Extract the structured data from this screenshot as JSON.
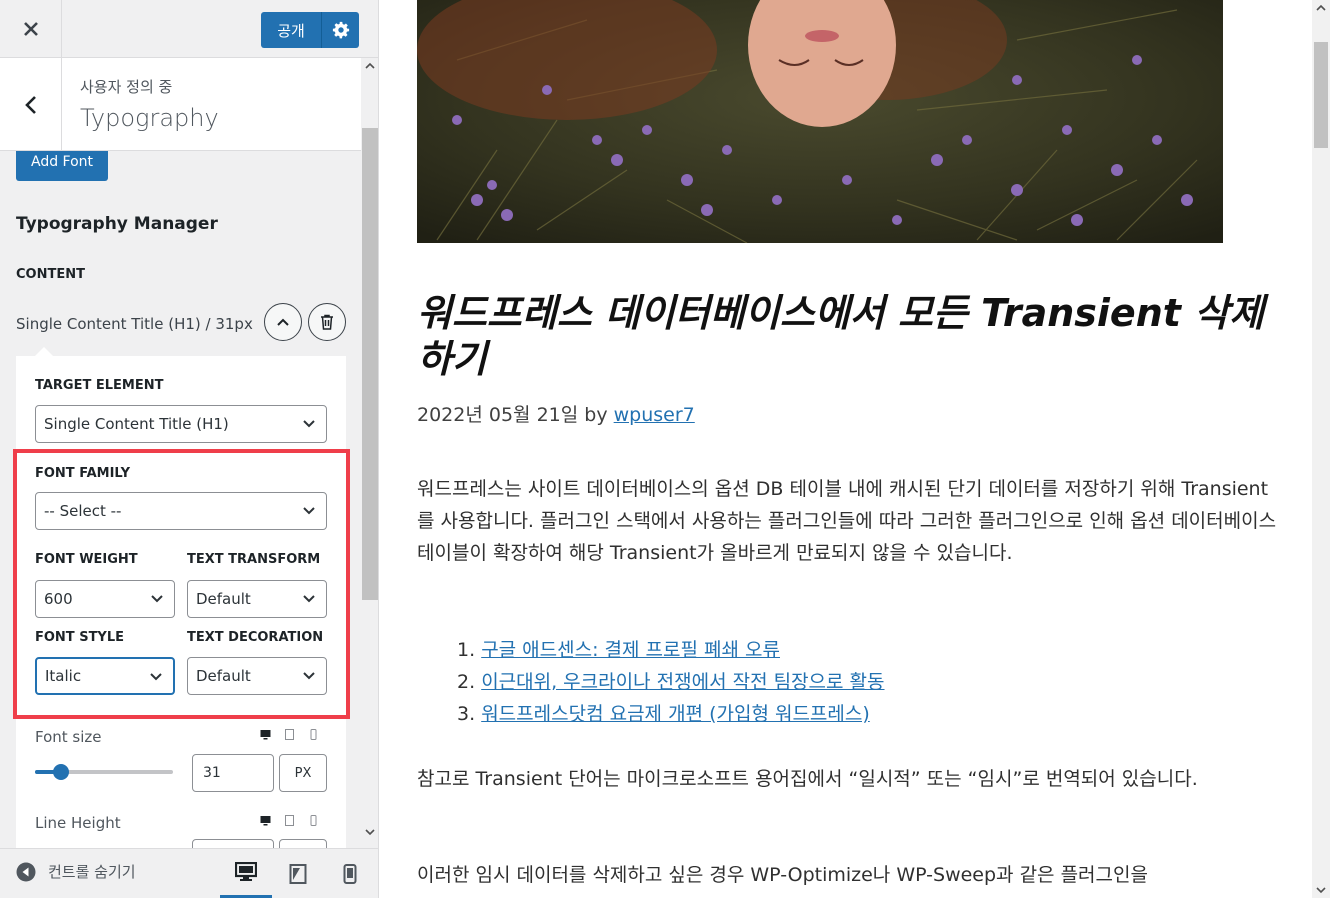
{
  "topbar": {
    "close_icon": "close-icon",
    "publish_label": "공개",
    "settings_icon": "gear-icon"
  },
  "section": {
    "subtitle": "사용자 정의 중",
    "title": "Typography"
  },
  "panel": {
    "add_font_label": "Add Font",
    "manager_title": "Typography Manager",
    "group_label": "CONTENT",
    "item_label": "Single Content Title (H1) / 31px",
    "target_label": "TARGET ELEMENT",
    "target_value": "Single Content Title (H1)",
    "font_family_label": "FONT FAMILY",
    "font_family_value": "-- Select --",
    "font_weight_label": "FONT WEIGHT",
    "font_weight_value": "600",
    "text_transform_label": "TEXT TRANSFORM",
    "text_transform_value": "Default",
    "font_style_label": "FONT STYLE",
    "font_style_value": "Italic",
    "text_decoration_label": "TEXT DECORATION",
    "text_decoration_value": "Default",
    "font_size_label": "Font size",
    "font_size_value": "31",
    "font_size_unit": "PX",
    "font_size_slider_fraction": 0.19,
    "line_height_label": "Line Height"
  },
  "footer": {
    "hide_controls_label": "컨트롤 숨기기",
    "active_device": "desktop"
  },
  "preview": {
    "post_title": "워드프레스 데이터베이스에서 모든 Transient 삭제하기",
    "date": "2022년 05월 21일",
    "by": "by",
    "author": "wpuser7",
    "paragraph1": "워드프레스는 사이트 데이터베이스의 옵션 DB 테이블 내에 캐시된 단기 데이터를 저장하기 위해 Transient를 사용합니다. 플러그인 스택에서 사용하는 플러그인들에 따라 그러한 플러그인으로 인해 옵션 데이터베이스 테이블이 확장하여 해당 Transient가 올바르게 만료되지 않을 수 있습니다.",
    "list": [
      {
        "num": "1.",
        "text": "구글 애드센스: 결제 프로필 폐쇄 오류"
      },
      {
        "num": "2.",
        "text": "이근대위, 우크라이나 전쟁에서 작전 팀장으로 활동"
      },
      {
        "num": "3.",
        "text": "워드프레스닷컴 요금제 개편 (가입형 워드프레스)"
      }
    ],
    "paragraph2": "참고로 Transient 단어는 마이크로소프트 용어집에서 “일시적” 또는 “임시”로 번역되어 있습니다.",
    "paragraph3": "이러한 임시 데이터를 삭제하고 싶은 경우 WP-Optimize나 WP-Sweep과 같은 플러그인을"
  },
  "colors": {
    "accent": "#2271b1",
    "highlight": "#ef3e4a"
  }
}
